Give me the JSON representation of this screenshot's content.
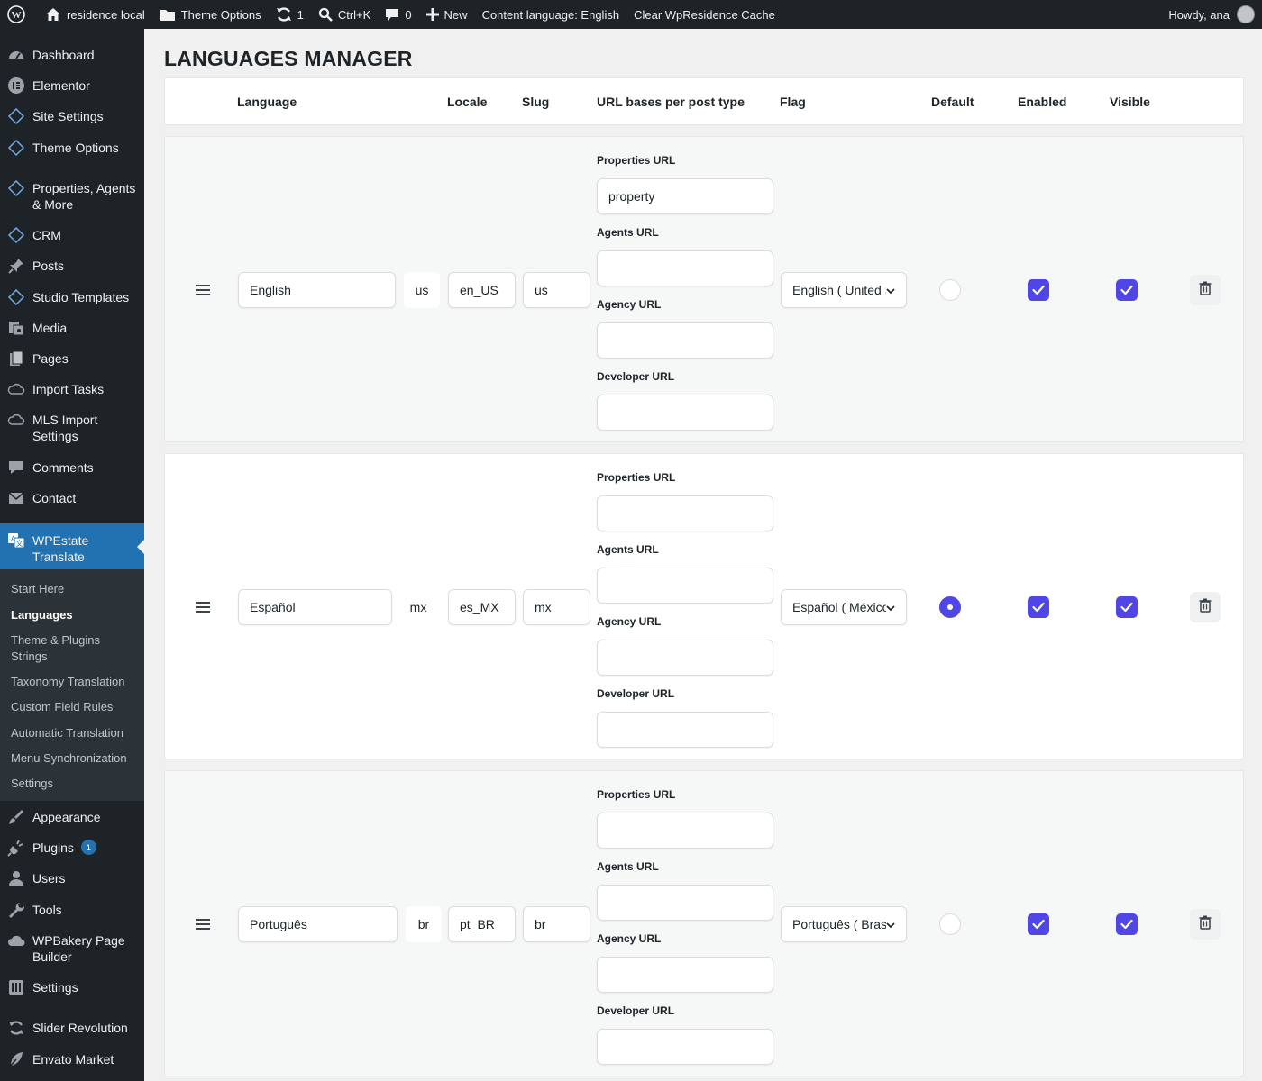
{
  "adminbar": {
    "site_name": "residence local",
    "theme_options": "Theme Options",
    "updates_count": "1",
    "shortcut": "Ctrl+K",
    "comments_count": "0",
    "new_label": "New",
    "content_language": "Content language: English",
    "clear_cache": "Clear WpResidence Cache",
    "howdy": "Howdy, ana"
  },
  "sidebar": {
    "items": [
      {
        "label": "Dashboard",
        "icon": "dashboard-icon"
      },
      {
        "label": "Elementor",
        "icon": "elementor-icon"
      },
      {
        "label": "Site Settings",
        "icon": "diamond-icon"
      },
      {
        "label": "Theme Options",
        "icon": "diamond-icon"
      },
      {
        "label": "Properties, Agents & More",
        "icon": "diamond-icon"
      },
      {
        "label": "CRM",
        "icon": "diamond-icon"
      },
      {
        "label": "Posts",
        "icon": "pin-icon"
      },
      {
        "label": "Studio Templates",
        "icon": "diamond-icon"
      },
      {
        "label": "Media",
        "icon": "media-icon"
      },
      {
        "label": "Pages",
        "icon": "pages-icon"
      },
      {
        "label": "Import Tasks",
        "icon": "cloud-icon"
      },
      {
        "label": "MLS Import Settings",
        "icon": "cloud-icon"
      },
      {
        "label": "Comments",
        "icon": "comment-icon"
      },
      {
        "label": "Contact",
        "icon": "mail-icon"
      },
      {
        "label": "WPEstate Translate",
        "icon": "translate-icon"
      }
    ],
    "submenu": [
      {
        "label": "Start Here"
      },
      {
        "label": "Languages"
      },
      {
        "label": "Theme & Plugins Strings"
      },
      {
        "label": "Taxonomy Translation"
      },
      {
        "label": "Custom Field Rules"
      },
      {
        "label": "Automatic Translation"
      },
      {
        "label": "Menu Synchronization"
      },
      {
        "label": "Settings"
      }
    ],
    "items_after": [
      {
        "label": "Appearance",
        "icon": "brush-icon"
      },
      {
        "label": "Plugins",
        "icon": "plugin-icon",
        "badge": "1"
      },
      {
        "label": "Users",
        "icon": "user-icon"
      },
      {
        "label": "Tools",
        "icon": "wrench-icon"
      },
      {
        "label": "WPBakery Page Builder",
        "icon": "cloud-solid-icon"
      },
      {
        "label": "Settings",
        "icon": "settings-icon"
      },
      {
        "label": "Slider Revolution",
        "icon": "refresh-icon"
      },
      {
        "label": "Envato Market",
        "icon": "leaf-icon"
      }
    ]
  },
  "page": {
    "title": "LANGUAGES MANAGER",
    "columns": {
      "language": "Language",
      "locale": "Locale",
      "slug": "Slug",
      "url_bases": "URL bases per post type",
      "flag": "Flag",
      "default": "Default",
      "enabled": "Enabled",
      "visible": "Visible"
    },
    "url_labels": {
      "properties": "Properties URL",
      "agents": "Agents URL",
      "agency": "Agency URL",
      "developer": "Developer URL"
    }
  },
  "languages": [
    {
      "name": "English",
      "code": "us",
      "locale": "en_US",
      "slug": "us",
      "properties_url": "property",
      "agents_url": "",
      "agency_url": "",
      "developer_url": "",
      "flag": "English ( United States )",
      "default": false,
      "enabled": true,
      "visible": true
    },
    {
      "name": "Español",
      "code": "mx",
      "locale": "es_MX",
      "slug": "mx",
      "properties_url": "",
      "agents_url": "",
      "agency_url": "",
      "developer_url": "",
      "flag": "Español ( México )",
      "default": true,
      "enabled": true,
      "visible": true
    },
    {
      "name": "Português",
      "code": "br",
      "locale": "pt_BR",
      "slug": "br",
      "properties_url": "",
      "agents_url": "",
      "agency_url": "",
      "developer_url": "",
      "flag": "Português ( Brasil )",
      "default": false,
      "enabled": true,
      "visible": true
    }
  ],
  "colors": {
    "accent": "#4f46e5",
    "admin_dark": "#1d2327",
    "admin_blue": "#2271b1"
  }
}
